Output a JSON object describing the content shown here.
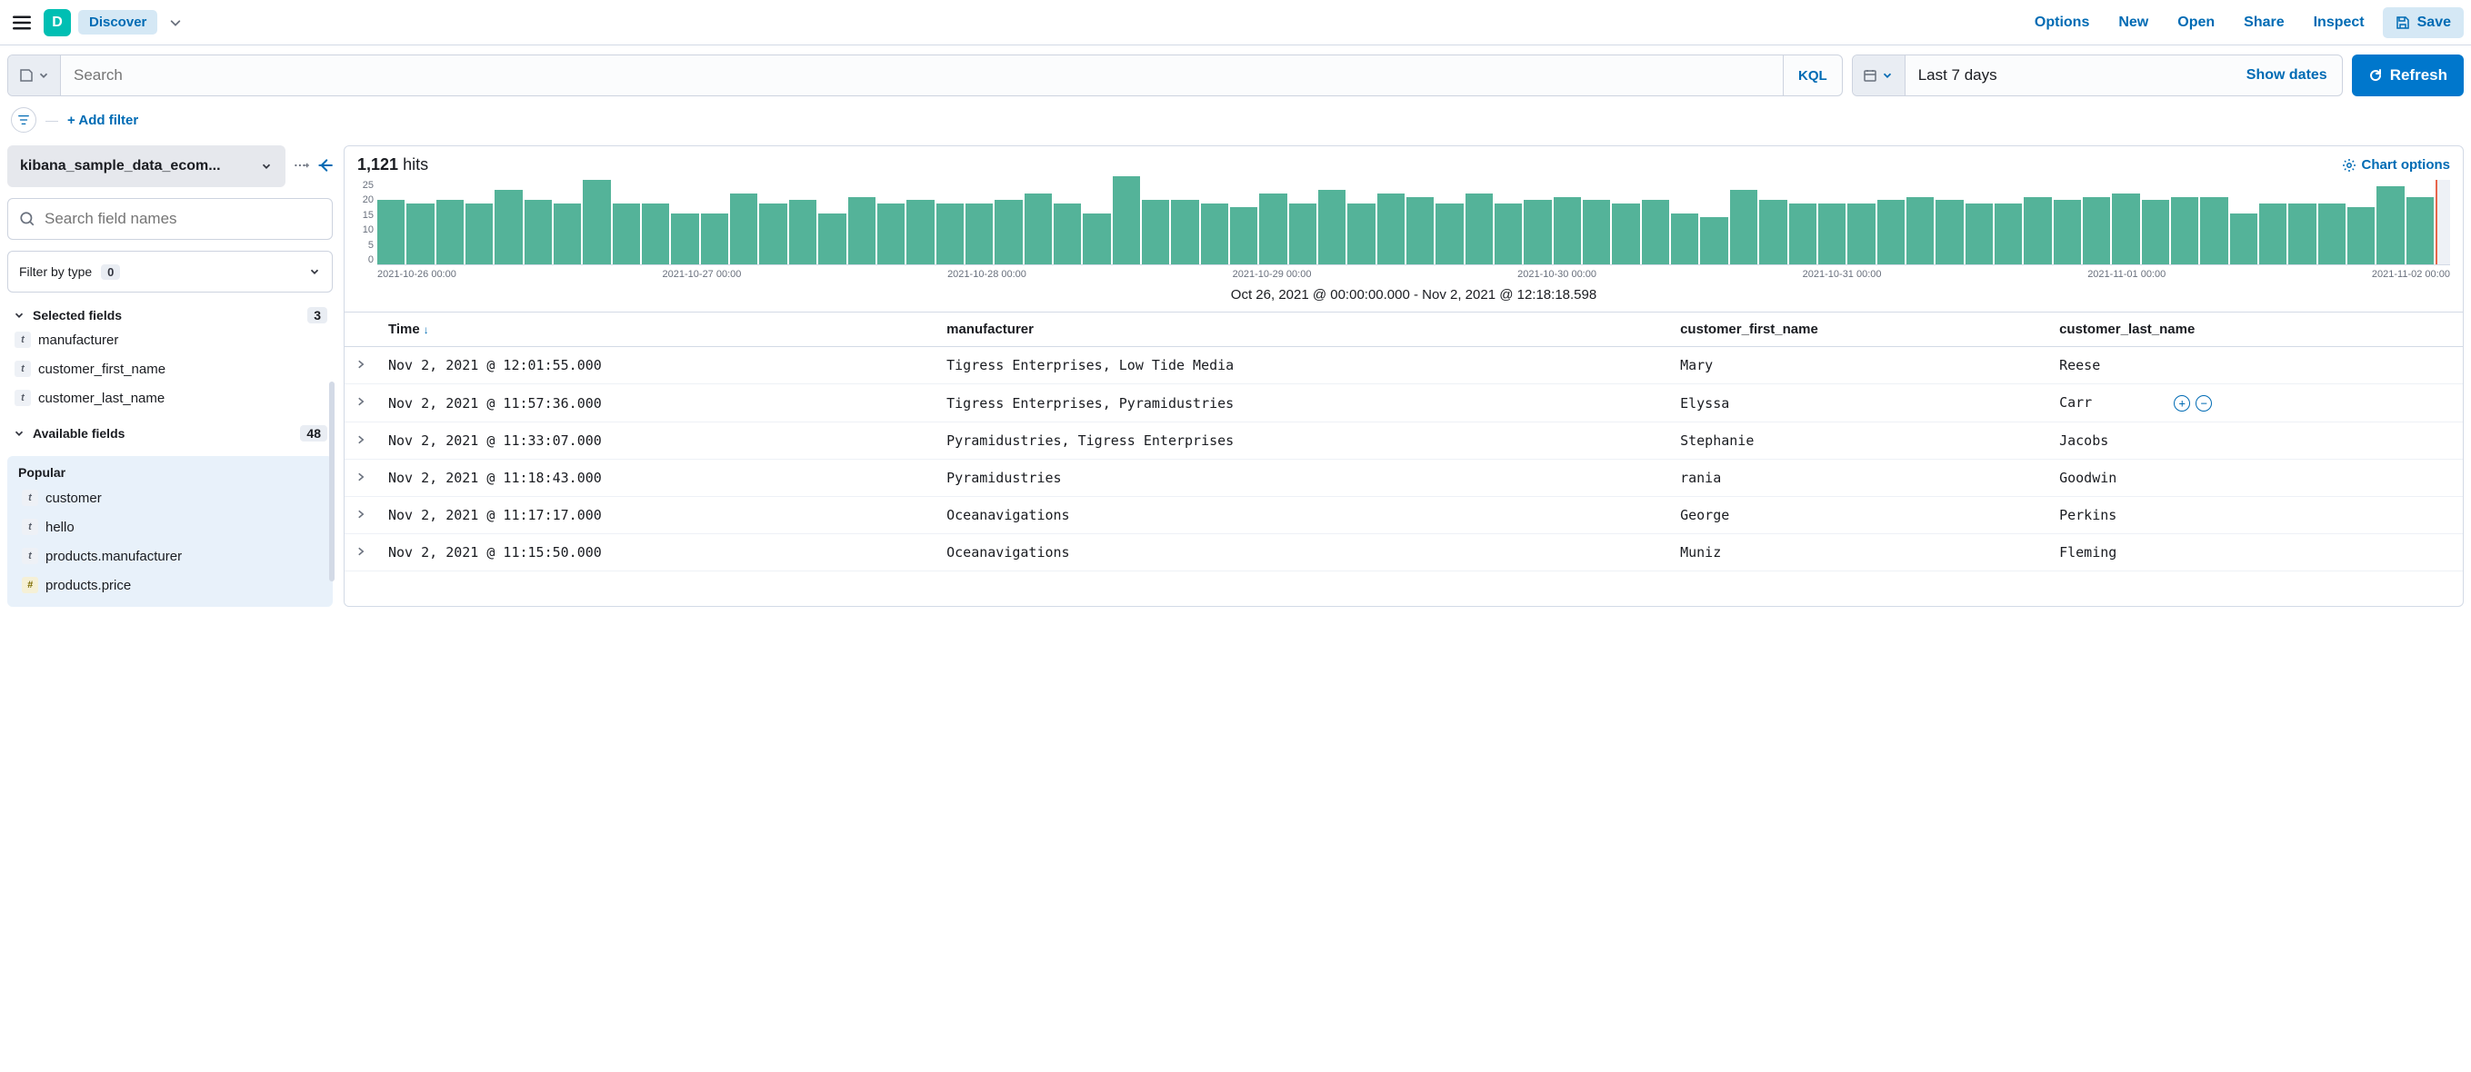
{
  "app": {
    "initial": "D",
    "name": "Discover"
  },
  "topnav": {
    "options": "Options",
    "new": "New",
    "open": "Open",
    "share": "Share",
    "inspect": "Inspect",
    "save": "Save"
  },
  "query": {
    "placeholder": "Search",
    "lang_badge": "KQL"
  },
  "timepicker": {
    "label": "Last 7 days",
    "show_dates": "Show dates",
    "refresh": "Refresh"
  },
  "filters": {
    "add_filter": "+ Add filter"
  },
  "sidebar": {
    "index_pattern": "kibana_sample_data_ecom...",
    "field_search_ph": "Search field names",
    "filter_by_type": "Filter by type",
    "filter_by_type_count": "0",
    "selected_label": "Selected fields",
    "selected_count": "3",
    "selected": [
      {
        "type": "t",
        "name": "manufacturer"
      },
      {
        "type": "t",
        "name": "customer_first_name"
      },
      {
        "type": "t",
        "name": "customer_last_name"
      }
    ],
    "available_label": "Available fields",
    "available_count": "48",
    "popular_label": "Popular",
    "popular": [
      {
        "type": "t",
        "name": "customer"
      },
      {
        "type": "t",
        "name": "hello"
      },
      {
        "type": "t",
        "name": "products.manufacturer"
      },
      {
        "type": "#",
        "name": "products.price"
      }
    ]
  },
  "results": {
    "hits_number": "1,121",
    "hits_word": "hits",
    "chart_options": "Chart options",
    "time_range_caption": "Oct 26, 2021 @ 00:00:00.000 - Nov 2, 2021 @ 12:18:18.598",
    "columns": {
      "time": "Time",
      "c1": "manufacturer",
      "c2": "customer_first_name",
      "c3": "customer_last_name"
    },
    "rows": [
      {
        "time": "Nov 2, 2021 @ 12:01:55.000",
        "manufacturer": "Tigress Enterprises, Low Tide Media",
        "first": "Mary",
        "last": "Reese"
      },
      {
        "time": "Nov 2, 2021 @ 11:57:36.000",
        "manufacturer": "Tigress Enterprises, Pyramidustries",
        "first": "Elyssa",
        "last": "Carr",
        "actions": true
      },
      {
        "time": "Nov 2, 2021 @ 11:33:07.000",
        "manufacturer": "Pyramidustries, Tigress Enterprises",
        "first": "Stephanie",
        "last": "Jacobs"
      },
      {
        "time": "Nov 2, 2021 @ 11:18:43.000",
        "manufacturer": "Pyramidustries",
        "first": "rania",
        "last": "Goodwin"
      },
      {
        "time": "Nov 2, 2021 @ 11:17:17.000",
        "manufacturer": "Oceanavigations",
        "first": "George",
        "last": "Perkins"
      },
      {
        "time": "Nov 2, 2021 @ 11:15:50.000",
        "manufacturer": "Oceanavigations",
        "first": "Muniz",
        "last": "Fleming"
      }
    ]
  },
  "chart_data": {
    "type": "bar",
    "title": "",
    "xlabel": "",
    "ylabel": "",
    "ylim": [
      0,
      25
    ],
    "y_ticks": [
      "25",
      "20",
      "15",
      "10",
      "5",
      "0"
    ],
    "x_ticks": [
      "2021-10-26 00:00",
      "2021-10-27 00:00",
      "2021-10-28 00:00",
      "2021-10-29 00:00",
      "2021-10-30 00:00",
      "2021-10-31 00:00",
      "2021-11-01 00:00",
      "2021-11-02 00:00"
    ],
    "values": [
      19,
      18,
      19,
      18,
      22,
      19,
      18,
      25,
      18,
      18,
      15,
      15,
      21,
      18,
      19,
      15,
      20,
      18,
      19,
      18,
      18,
      19,
      21,
      18,
      15,
      26,
      19,
      19,
      18,
      17,
      21,
      18,
      22,
      18,
      21,
      20,
      18,
      21,
      18,
      19,
      20,
      19,
      18,
      19,
      15,
      14,
      22,
      19,
      18,
      18,
      18,
      19,
      20,
      19,
      18,
      18,
      20,
      19,
      20,
      21,
      19,
      20,
      20,
      15,
      18,
      18,
      18,
      17,
      23,
      20
    ],
    "marker_note": "current time"
  }
}
